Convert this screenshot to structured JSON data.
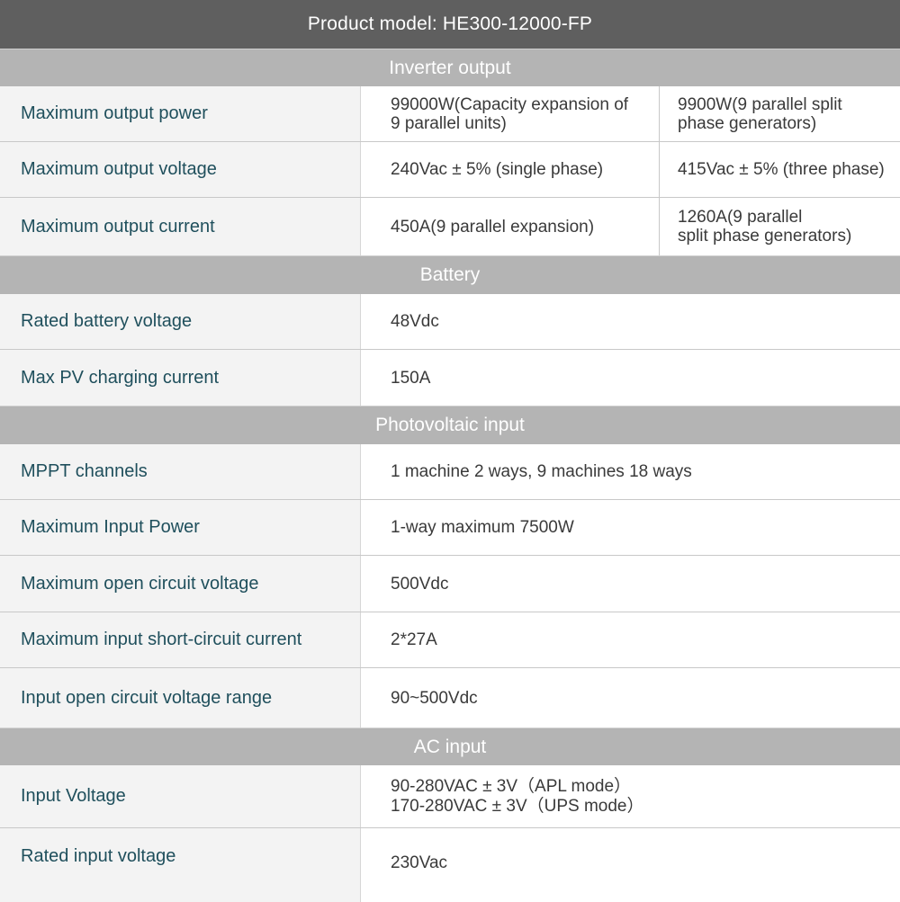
{
  "title": "Product model: HE300-12000-FP",
  "sections": {
    "inverter": {
      "header": "Inverter output",
      "rows": [
        {
          "label": "Maximum output power",
          "left": [
            "99000W(Capacity expansion of",
            "9 parallel units)"
          ],
          "right": [
            "9900W(9 parallel split",
            "phase generators)"
          ]
        },
        {
          "label": "Maximum output voltage",
          "left": [
            "240Vac ± 5% (single phase)"
          ],
          "right": [
            "415Vac ± 5% (three phase)"
          ]
        },
        {
          "label": "Maximum output current",
          "left": [
            "450A(9 parallel expansion)"
          ],
          "right": [
            "1260A(9 parallel",
            "split phase generators)"
          ]
        }
      ]
    },
    "battery": {
      "header": "Battery",
      "rows": [
        {
          "label": "Rated battery voltage",
          "value": "48Vdc"
        },
        {
          "label": "Max PV charging current",
          "value": "150A"
        }
      ]
    },
    "pv": {
      "header": "Photovoltaic input",
      "rows": [
        {
          "label": "MPPT channels",
          "value": "1 machine 2 ways, 9 machines 18 ways"
        },
        {
          "label": "Maximum Input Power",
          "value": "1-way maximum 7500W"
        },
        {
          "label": "Maximum open circuit voltage",
          "value": "500Vdc"
        },
        {
          "label": "Maximum input short-circuit current",
          "value": "2*27A"
        },
        {
          "label": "Input open circuit voltage range",
          "value": "90~500Vdc"
        }
      ]
    },
    "ac": {
      "header": "AC input",
      "rows": [
        {
          "label": "Input Voltage",
          "lines": [
            "90-280VAC ± 3V（APL mode）",
            "170-280VAC ± 3V（UPS mode）"
          ]
        },
        {
          "label": "Rated input voltage",
          "value": "230Vac"
        }
      ]
    }
  }
}
